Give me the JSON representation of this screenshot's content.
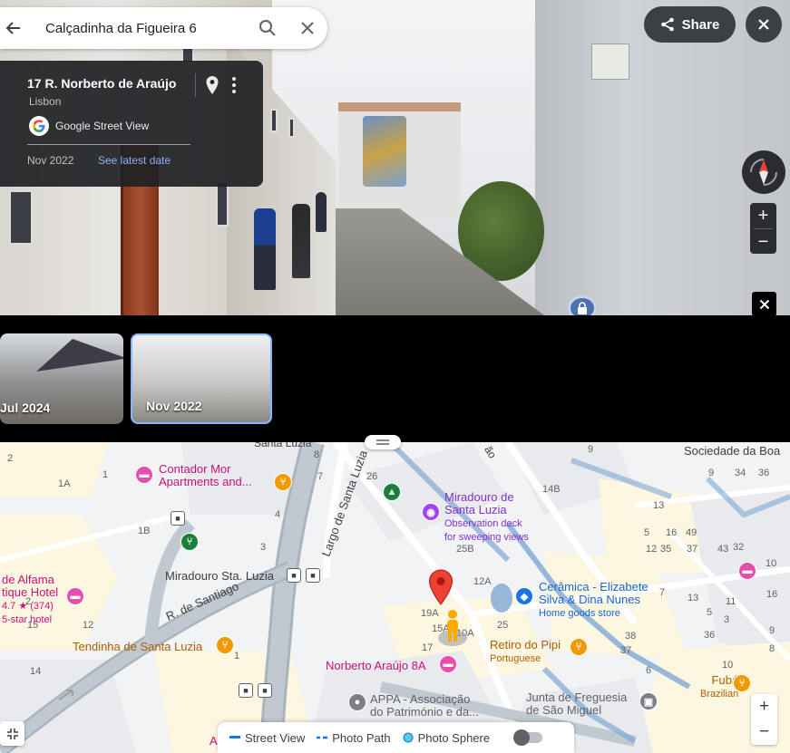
{
  "search": {
    "query": "Calçadinha da Figueira 6"
  },
  "info_card": {
    "address": "17 R. Norberto de Araújo",
    "city": "Lisbon",
    "source": "Google Street View",
    "date": "Nov 2022",
    "latest_link": "See latest date"
  },
  "toolbar": {
    "share_label": "Share"
  },
  "street_view_controls": {
    "zoom_in": "+",
    "zoom_out": "−"
  },
  "timeline": {
    "thumbnails": [
      {
        "label": "Jul 2024",
        "selected": false
      },
      {
        "label": "Nov 2022",
        "selected": true
      }
    ]
  },
  "map": {
    "streets": {
      "santa_luzia_top": "Santa Luzia",
      "largo": "Largo de Santa Luzia",
      "santiago": "R. de Santiago",
      "rua_top": "ão"
    },
    "places": {
      "contador": {
        "line1": "Contador Mor",
        "line2": "Apartments and..."
      },
      "miradouro": {
        "line1": "Miradouro de",
        "line2": "Santa Luzia",
        "sub1": "Observation deck",
        "sub2": "for sweeping views"
      },
      "miradouro_sta": "Miradouro Sta. Luzia",
      "alfama": {
        "line1": "de Alfama",
        "line2": "tique Hotel",
        "rating": "4.7 ★ (374)",
        "sub": "5-star hotel"
      },
      "ceramica": {
        "line1": "Cerâmica - Elizabete",
        "line2": "Silva & Dina Nunes",
        "sub": "Home goods store"
      },
      "tendinha": "Tendinha de Santa Luzia",
      "retiro": {
        "line1": "Retiro do Pipi",
        "sub": "Portuguese"
      },
      "norberto": "Norberto Araújo 8A",
      "appa": {
        "line1": "APPA - Associação",
        "line2": "do Património e da..."
      },
      "junta": {
        "line1": "Junta de Freguesia",
        "line2": "de São Miguel"
      },
      "fuba": {
        "line1": "Fubá",
        "sub": "Brazilian"
      },
      "sociedade": "Sociedade da Boa"
    },
    "numbers": [
      "2",
      "1A",
      "1",
      "8",
      "7",
      "26",
      "9",
      "14B",
      "9",
      "34",
      "36",
      "1B",
      "4",
      "3",
      "13",
      "5",
      "16",
      "49",
      "25B",
      "12",
      "35",
      "37",
      "43",
      "32",
      "10",
      "12A",
      "2",
      "16",
      "13",
      "7",
      "5",
      "11",
      "19A",
      "15A",
      "10A",
      "25",
      "15",
      "12",
      "38",
      "3",
      "17",
      "14",
      "37",
      "36",
      "9",
      "6",
      "10",
      "8",
      "1",
      "A"
    ],
    "legend": {
      "street_view": "Street View",
      "photo_path": "Photo Path",
      "photo_sphere": "Photo Sphere"
    },
    "zoom_in": "+",
    "zoom_out": "−"
  },
  "colors": {
    "accent_blue": "#8ab4f8",
    "pin_red": "#ea4335",
    "poi_pink": "#c5117a",
    "poi_orange": "#b06000"
  }
}
